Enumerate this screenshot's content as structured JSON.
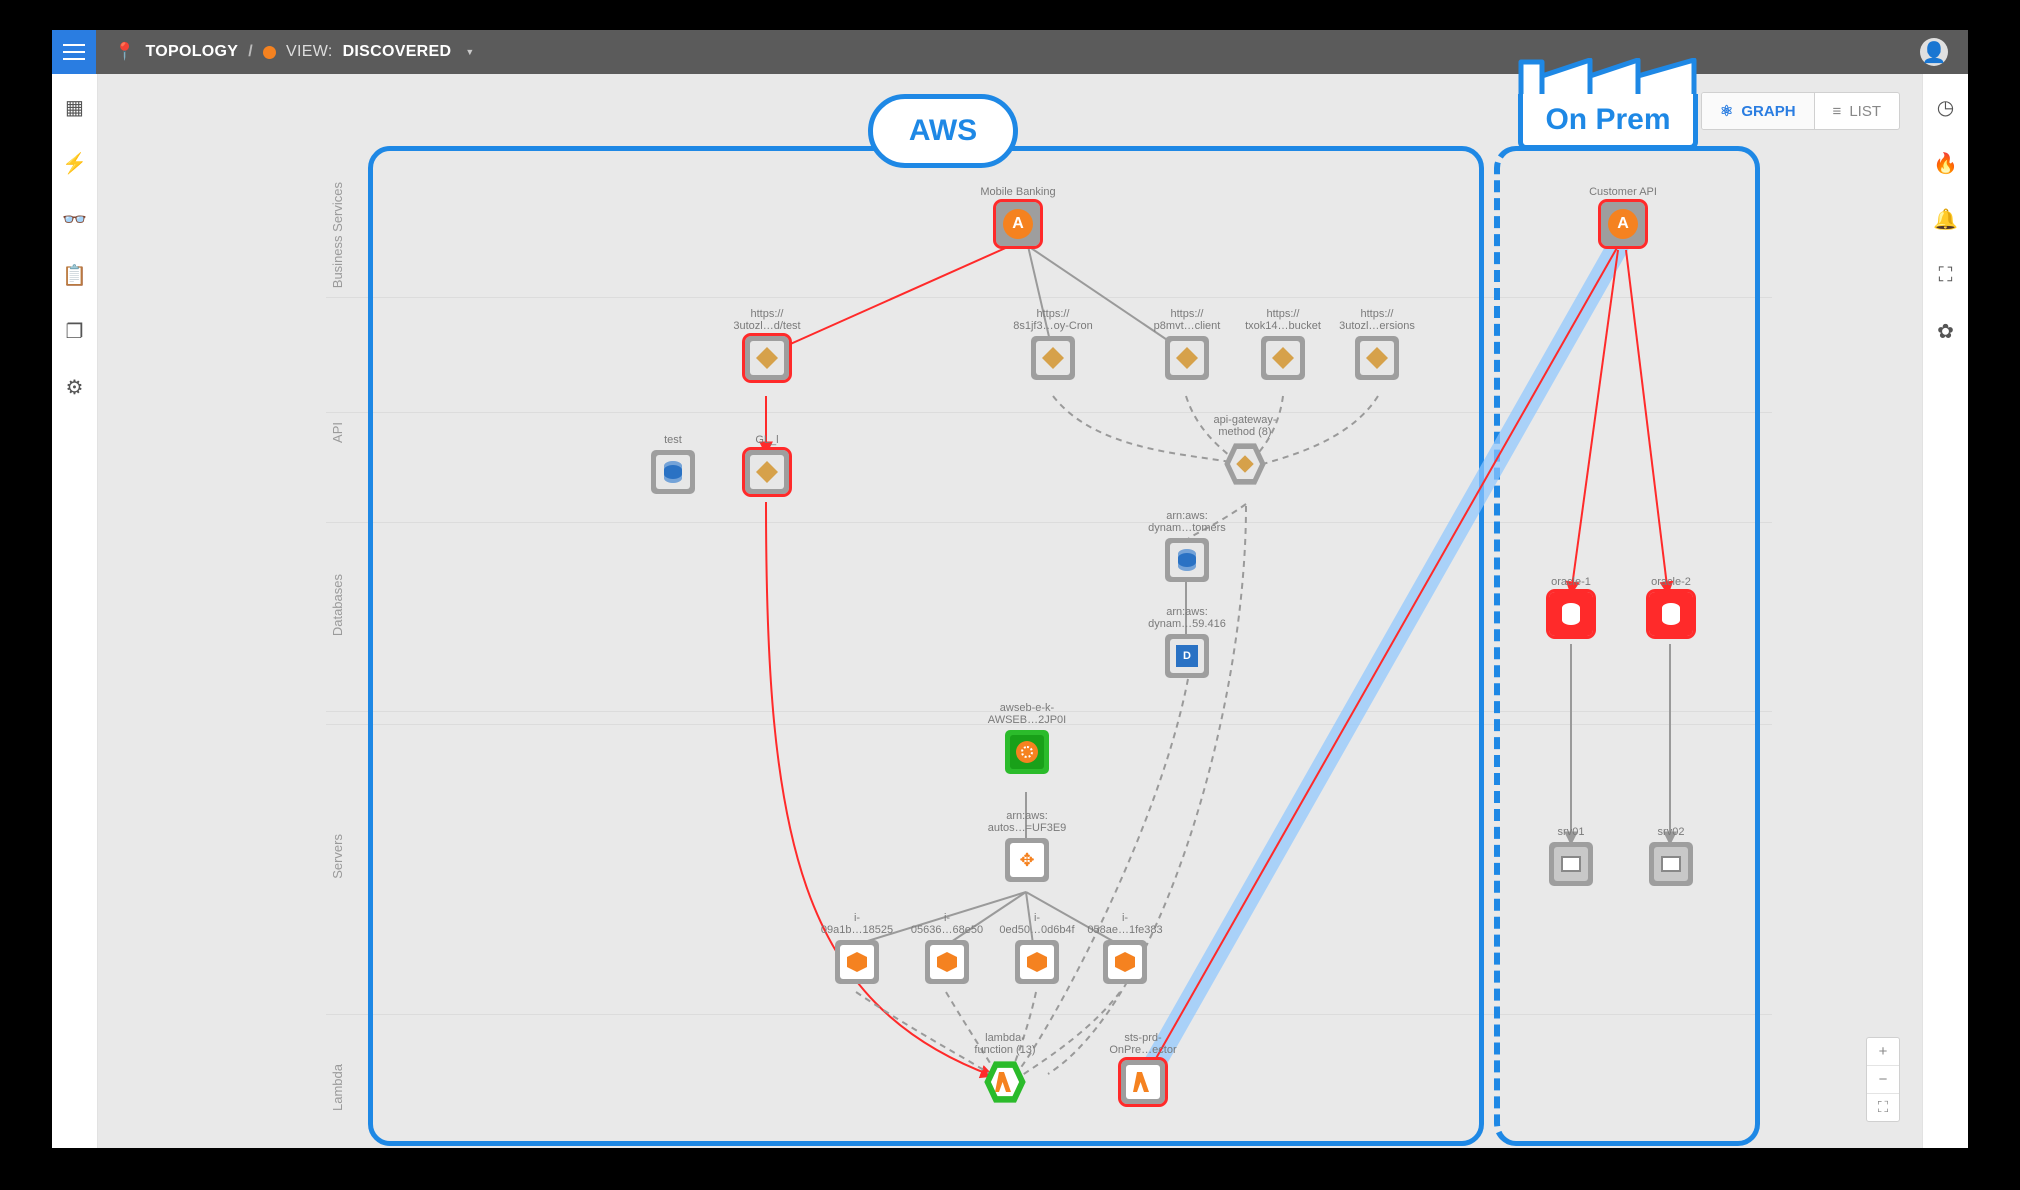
{
  "topbar": {
    "crumb1": "TOPOLOGY",
    "sep": "/",
    "view_label": "VIEW:",
    "view_value": "DISCOVERED"
  },
  "viewtoggle": {
    "graph": "GRAPH",
    "list": "LIST"
  },
  "regions": {
    "aws": "AWS",
    "onprem": "On Prem"
  },
  "bands": {
    "biz": "Business Services",
    "api": "API",
    "db": "Databases",
    "srv": "Servers",
    "lam": "Lambda"
  },
  "nodes": {
    "mobile_banking": "Mobile Banking",
    "customer_api": "Customer API",
    "ep_test": "https://\n3utozl…d/test",
    "ep_cron": "https://\n8s1jf3…oy-Cron",
    "ep_client": "https://\np8mvt…client",
    "ep_bucket": "https://\ntxok14…bucket",
    "ep_ersions": "https://\n3utozl…ersions",
    "api_test": "test",
    "api_gl": "GL_l",
    "api_gw": "api-gateway-\nmethod (8)",
    "dyn1": "arn:aws:\ndynam…tomers",
    "dyn2": "arn:aws:\ndynam…59.416",
    "elb": "awseb-e-k-\nAWSEB…2JP0I",
    "asg": "arn:aws:\nautos…=UF3E9",
    "ec2a": "i-\n09a1b…18525",
    "ec2b": "i-\n05636…68e50",
    "ec2c": "i-\n0ed50…0d6b4f",
    "ec2d": "i-\n058ae…1fe383",
    "lamgrp": "lambda-\nfunction (13)",
    "lamconn": "sts-prd-\nOnPre…ector",
    "oracle1": "oracle-1",
    "oracle2": "oracle-2",
    "srv01": "srv01",
    "srv02": "srv02"
  },
  "rail_left": [
    "grid",
    "bolt",
    "glasses",
    "clipboard",
    "window",
    "gear"
  ],
  "rail_right": [
    "globe",
    "flame",
    "bell",
    "expand",
    "puzzle"
  ]
}
